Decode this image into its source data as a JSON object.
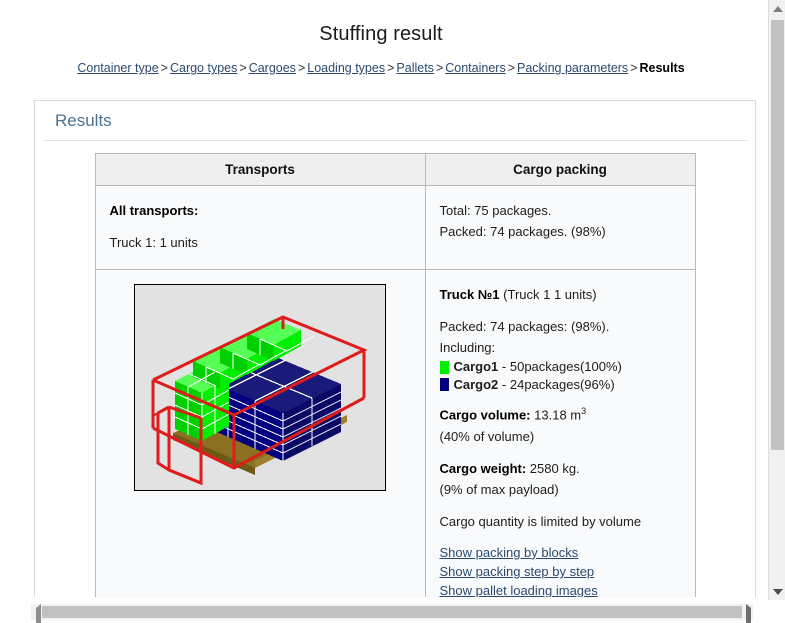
{
  "page": {
    "title": "Stuffing result"
  },
  "breadcrumb": {
    "items": [
      {
        "label": "Container type",
        "current": false
      },
      {
        "label": "Cargo types",
        "current": false
      },
      {
        "label": "Cargoes",
        "current": false
      },
      {
        "label": "Loading types",
        "current": false
      },
      {
        "label": "Pallets",
        "current": false
      },
      {
        "label": "Containers",
        "current": false
      },
      {
        "label": "Packing parameters",
        "current": false
      },
      {
        "label": "Results",
        "current": true
      }
    ],
    "separator": ">"
  },
  "panel": {
    "legend": "Results"
  },
  "table": {
    "headers": {
      "transports": "Transports",
      "cargo_packing": "Cargo packing"
    },
    "summary_row": {
      "transports_title": "All transports:",
      "transports_line": "Truck 1: 1 units",
      "packing_total": "Total: 75 packages.",
      "packing_packed": "Packed: 74 packages. (98%)"
    },
    "detail_row": {
      "truck_name": "Truck №1",
      "truck_desc": "(Truck 1 1 units)",
      "packed_line": "Packed: 74 packages: (98%).",
      "including_label": "Including:",
      "cargo_legend": [
        {
          "name": "Cargo1",
          "detail": "- 50packages(100%)",
          "color": "#00ee00"
        },
        {
          "name": "Cargo2",
          "detail": "- 24packages(96%)",
          "color": "#000080"
        }
      ],
      "volume_label": "Cargo volume:",
      "volume_value": "13.18 m",
      "volume_exponent": "3",
      "volume_note": "(40% of volume)",
      "weight_label": "Cargo weight:",
      "weight_value": "2580 kg.",
      "weight_note": "(9% of max payload)",
      "limit_note": "Cargo quantity is limited by volume",
      "links": [
        "Show packing by blocks",
        "Show packing step by step ",
        "Show pallet loading images"
      ]
    }
  },
  "diagram": {
    "name": "truck-loading-3d-view",
    "background": "#e2e2e2",
    "border": "#000000",
    "wireframe_color": "#e01b1b",
    "cargo1_color": "#00ee00",
    "cargo2_color": "#000080",
    "pallet_color": "#8a7020",
    "edge_color": "#ffffff"
  },
  "scrollbars": {
    "vertical": {
      "up": "▲",
      "down": "▼"
    },
    "horizontal": {
      "left": "◀",
      "right": "▶"
    }
  }
}
